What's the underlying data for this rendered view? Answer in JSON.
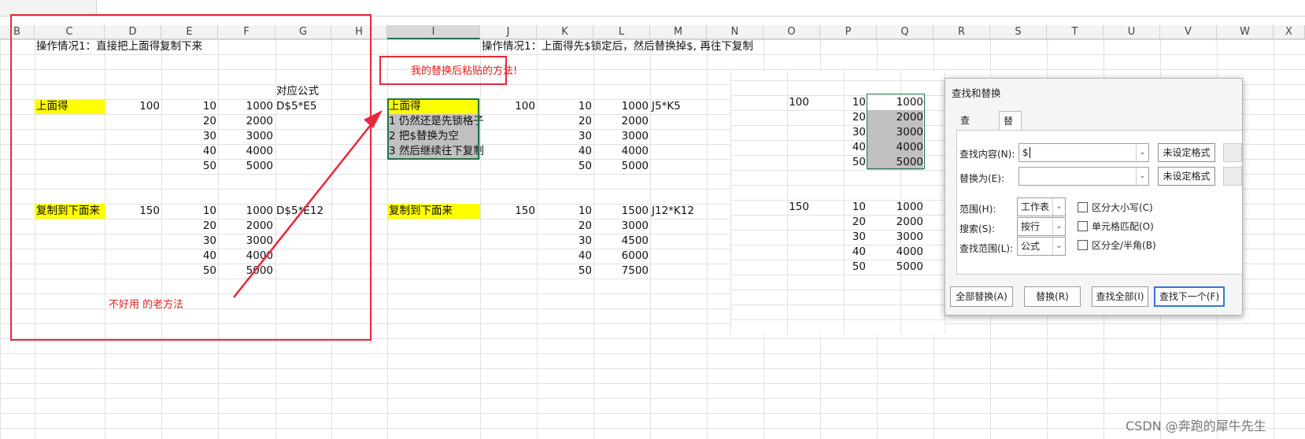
{
  "columns": [
    "B",
    "C",
    "D",
    "E",
    "F",
    "G",
    "H",
    "I",
    "J",
    "K",
    "L",
    "M",
    "N",
    "O",
    "P",
    "Q",
    "R",
    "S",
    "T",
    "U",
    "V",
    "W",
    "X"
  ],
  "selected_column": "I",
  "left_section": {
    "note": "操作情况1：直接把上面得复制下来",
    "formula_header": "对应公式",
    "label_top": "上面得",
    "value_top": "100",
    "e_top": [
      "10",
      "20",
      "30",
      "40",
      "50"
    ],
    "f_top": [
      "1000",
      "2000",
      "3000",
      "4000",
      "5000"
    ],
    "formula_top": "D$5*E5",
    "label_bottom": "复制到下面来",
    "value_bottom": "150",
    "e_bottom": [
      "10",
      "20",
      "30",
      "40",
      "50"
    ],
    "f_bottom": [
      "1000",
      "2000",
      "3000",
      "4000",
      "5000"
    ],
    "formula_bottom": "D$5*E12",
    "annotation": "不好用 的老方法"
  },
  "middle_section": {
    "note": "操作情况1：上面得先$锁定后，然后替换掉$, 再往下复制",
    "callout": "我的替换后粘贴的方法!",
    "label_top": "上面得",
    "steps": [
      "1 仍然还是先锁格子",
      "2 把$替换为空",
      "3 然后继续往下复制"
    ],
    "value_top": "100",
    "k_top": [
      "10",
      "20",
      "30",
      "40",
      "50"
    ],
    "l_top": [
      "1000",
      "2000",
      "3000",
      "4000",
      "5000"
    ],
    "formula_top": "J5*K5",
    "label_bottom": "复制到下面来",
    "value_bottom": "150",
    "k_bottom": [
      "10",
      "20",
      "30",
      "40",
      "50"
    ],
    "l_bottom": [
      "1500",
      "3000",
      "4500",
      "6000",
      "7500"
    ],
    "formula_bottom": "J12*K12"
  },
  "right_section": {
    "value_top": "100",
    "p_top": [
      "10",
      "20",
      "30",
      "40",
      "50"
    ],
    "q_top": [
      "1000",
      "2000",
      "3000",
      "4000",
      "5000"
    ],
    "value_bottom": "150",
    "p_bottom": [
      "10",
      "20",
      "30",
      "40",
      "50"
    ],
    "q_bottom": [
      "1000",
      "2000",
      "3000",
      "4000",
      "5000"
    ]
  },
  "dialog": {
    "title": "查找和替换",
    "tab_find": "查找(D)",
    "tab_replace": "替换(P)",
    "find_label": "查找内容(N):",
    "find_value": "$",
    "replace_label": "替换为(E):",
    "replace_value": "",
    "format_button": "未设定格式",
    "scope_label": "范围(H):",
    "scope_value": "工作表",
    "search_label": "搜索(S):",
    "search_value": "按行",
    "lookin_label": "查找范围(L):",
    "lookin_value": "公式",
    "match_case": "区分大小写(C)",
    "match_cell": "单元格匹配(O)",
    "match_width": "区分全/半角(B)",
    "btn_replace_all": "全部替换(A)",
    "btn_replace": "替换(R)",
    "btn_find_all": "查找全部(I)",
    "btn_find_next": "查找下一个(F)"
  },
  "watermark": "CSDN @奔跑的犀牛先生",
  "colors": {
    "accent": "#217346",
    "highlight": "#ffff00",
    "annotation": "#e8283a",
    "dialog_primary": "#3477d4"
  }
}
